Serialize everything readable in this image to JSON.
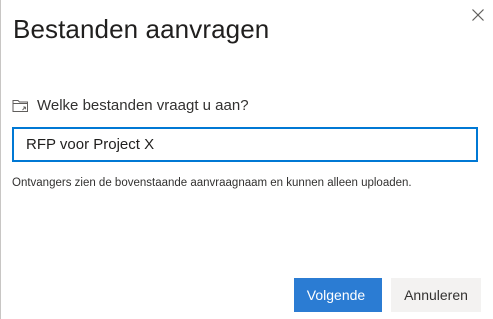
{
  "dialog": {
    "title": "Bestanden aanvragen",
    "close_icon": "close-icon",
    "question": {
      "icon": "folder-request-icon",
      "label": "Welke bestanden vraagt u aan?"
    },
    "input": {
      "value": "RFP voor Project X"
    },
    "hint": "Ontvangers zien de bovenstaande aanvraagnaam en kunnen alleen uploaden.",
    "buttons": {
      "next_label": "Volgende",
      "cancel_label": "Annuleren"
    }
  },
  "colors": {
    "accent": "#0078d4",
    "primary_button": "#2b7cd3",
    "secondary_button": "#f3f2f1",
    "text": "#323130"
  }
}
